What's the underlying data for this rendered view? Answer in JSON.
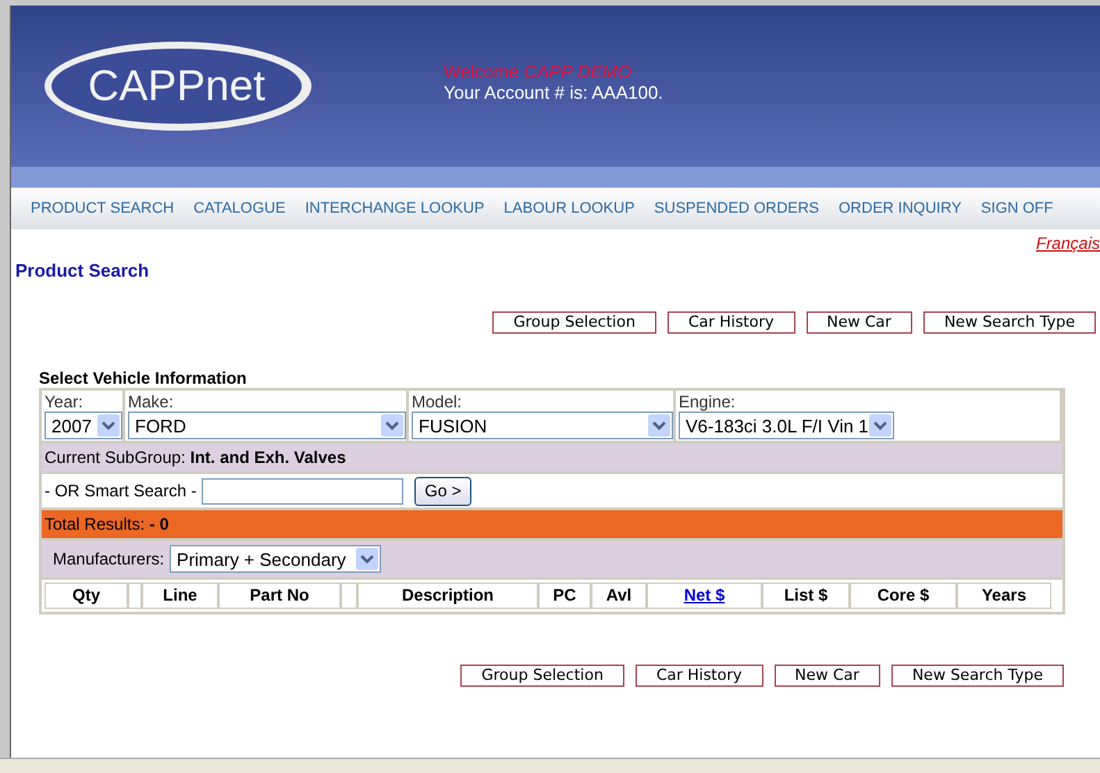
{
  "header": {
    "logo": "CAPPnet",
    "welcome": "Welcome",
    "user": "CAPP DEMO",
    "account": "Your Account # is: AAA100."
  },
  "nav": [
    "PRODUCT SEARCH",
    "CATALOGUE",
    "INTERCHANGE LOOKUP",
    "LABOUR LOOKUP",
    "SUSPENDED ORDERS",
    "ORDER INQUIRY",
    "SIGN OFF"
  ],
  "language_link": "Français",
  "page_title": "Product Search",
  "top_buttons": [
    "Group Selection",
    "Car History",
    "New Car",
    "New Search Type"
  ],
  "vehicle": {
    "title": "Select Vehicle Information",
    "fields": [
      {
        "label": "Year:",
        "value": "2007"
      },
      {
        "label": "Make:",
        "value": "FORD"
      },
      {
        "label": "Model:",
        "value": "FUSION"
      },
      {
        "label": "Engine:",
        "value": "V6-183ci 3.0L F/I Vin 1"
      }
    ]
  },
  "subgroup": {
    "label": "Current SubGroup:",
    "value": "Int. and Exh. Valves"
  },
  "smart_search": {
    "label": "- OR Smart Search -",
    "button": "Go >"
  },
  "total_results": {
    "label": "Total Results:",
    "value": "- 0"
  },
  "manufacturers": {
    "label": "Manufacturers:",
    "value": "Primary + Secondary"
  },
  "table": {
    "columns": [
      {
        "label": "Qty",
        "kind": "text"
      },
      {
        "kind": "blank"
      },
      {
        "label": "Line",
        "kind": "text"
      },
      {
        "label": "Part No",
        "kind": "text"
      },
      {
        "kind": "blank"
      },
      {
        "label": "Description",
        "kind": "text"
      },
      {
        "label": "PC",
        "kind": "text"
      },
      {
        "label": "Avl",
        "kind": "text"
      },
      {
        "label": "Net $",
        "kind": "link"
      },
      {
        "label": "List $",
        "kind": "text"
      },
      {
        "label": "Core $",
        "kind": "text"
      },
      {
        "label": "Years",
        "kind": "text"
      }
    ]
  },
  "bottom_buttons": [
    "Group Selection",
    "Car History",
    "New Car",
    "New Search Type"
  ]
}
